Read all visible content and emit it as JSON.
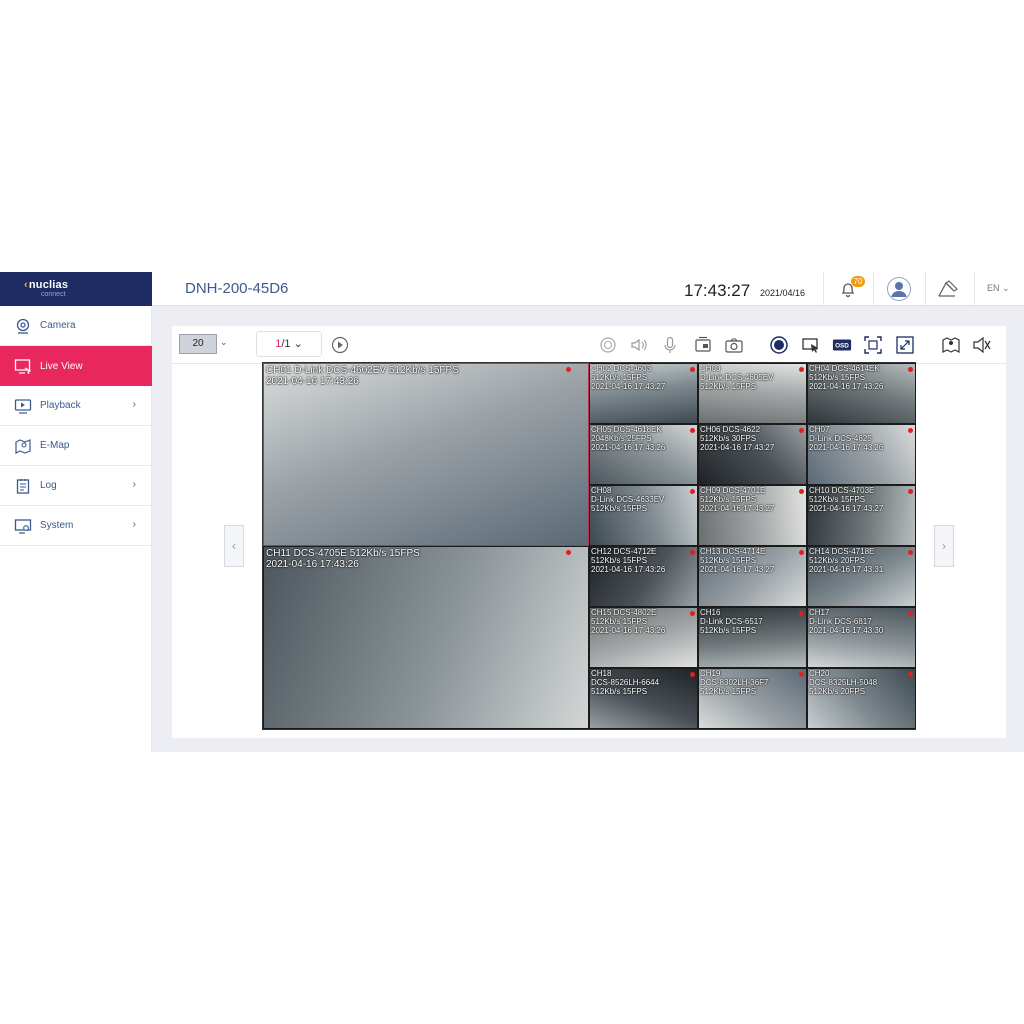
{
  "sidebar": {
    "logo": {
      "brand": "nuclias",
      "sub": "connect"
    },
    "items": [
      {
        "label": "Camera",
        "icon": "camera-icon",
        "active": false,
        "has_submenu": false
      },
      {
        "label": "Live View",
        "icon": "live-view-icon",
        "active": true,
        "has_submenu": false
      },
      {
        "label": "Playback",
        "icon": "playback-icon",
        "active": false,
        "has_submenu": true
      },
      {
        "label": "E-Map",
        "icon": "e-map-icon",
        "active": false,
        "has_submenu": false
      },
      {
        "label": "Log",
        "icon": "log-icon",
        "active": false,
        "has_submenu": true
      },
      {
        "label": "System",
        "icon": "system-icon",
        "active": false,
        "has_submenu": true
      }
    ]
  },
  "header": {
    "device_name": "DNH-200-45D6",
    "time": "17:43:27",
    "date": "2021/04/16",
    "notification_count": "70",
    "language": "EN"
  },
  "toolbar": {
    "layout_value": "20",
    "page_current": "1",
    "page_total": "/1",
    "tools": [
      "play-icon",
      "ptz-icon",
      "speaker-icon",
      "microphone-icon",
      "stream-icon",
      "snapshot-icon",
      "record-icon",
      "camera-control-icon",
      "osd-icon",
      "focus-icon",
      "fullscreen-icon",
      "emap-icon",
      "alarm-output-icon"
    ]
  },
  "colors": {
    "brand_navy": "#1d2c63",
    "accent_pink": "#e8275f",
    "badge_orange": "#f39c12",
    "record_red": "#e02020"
  },
  "channels": [
    {
      "line1": "CH01  D-Link DCS-4602EV  512Kb/s  15FPS",
      "line2": "2021-04-16  17:43:26",
      "line3": ""
    },
    {
      "line1": "CH02  DCS-4603",
      "line2": "512Kb/s  15FPS",
      "line3": "2021-04-16  17:43:27"
    },
    {
      "line1": "CH03",
      "line2": "D-Link DCS-4605EV",
      "line3": "512Kb/s  15FPS"
    },
    {
      "line1": "CH04  DCS-4614EK",
      "line2": "512Kb/s  15FPS",
      "line3": "2021-04-16  17:43:26"
    },
    {
      "line1": "CH05  DCS-4618EK",
      "line2": "2048Kb/s  25FPS",
      "line3": "2021-04-16  17:43:26"
    },
    {
      "line1": "CH06  DCS-4622",
      "line2": "512Kb/s  30FPS",
      "line3": "2021-04-16  17:43:27"
    },
    {
      "line1": "CH07",
      "line2": "D-Link DCS-4625",
      "line3": "2021-04-16  17:43:26"
    },
    {
      "line1": "CH08",
      "line2": "D-Link DCS-4633EV",
      "line3": "512Kb/s  15FPS"
    },
    {
      "line1": "CH09  DCS-4701E",
      "line2": "512Kb/s  15FPS",
      "line3": "2021-04-16  17:43:27"
    },
    {
      "line1": "CH10  DCS-4703E",
      "line2": "512Kb/s  15FPS",
      "line3": "2021-04-16  17:43:27"
    },
    {
      "line1": "CH11  DCS-4705E  512Kb/s  15FPS",
      "line2": "2021-04-16  17:43:26",
      "line3": ""
    },
    {
      "line1": "CH12  DCS-4712E",
      "line2": "512Kb/s  15FPS",
      "line3": "2021-04-16  17:43:26"
    },
    {
      "line1": "CH13  DCS-4714E",
      "line2": "512Kb/s  15FPS",
      "line3": "2021-04-16  17:43:27"
    },
    {
      "line1": "CH14  DCS-4718E",
      "line2": "512Kb/s  20FPS",
      "line3": "2021-04-16  17:43:31"
    },
    {
      "line1": "CH15  DCS-4802E",
      "line2": "512Kb/s  15FPS",
      "line3": "2021-04-16  17:43:26"
    },
    {
      "line1": "CH16",
      "line2": "D-Link DCS-6517",
      "line3": "512Kb/s  15FPS"
    },
    {
      "line1": "CH17",
      "line2": "D-Link DCS-6817",
      "line3": "2021-04-16  17:43:30"
    },
    {
      "line1": "CH18",
      "line2": "DCS-8526LH-6644",
      "line3": "512Kb/s  15FPS"
    },
    {
      "line1": "CH19",
      "line2": "DCS-8302LH-36F7",
      "line3": "512Kb/s  15FPS"
    },
    {
      "line1": "CH20",
      "line2": "DCS-8325LH-5048",
      "line3": "512Kb/s  20FPS"
    }
  ]
}
